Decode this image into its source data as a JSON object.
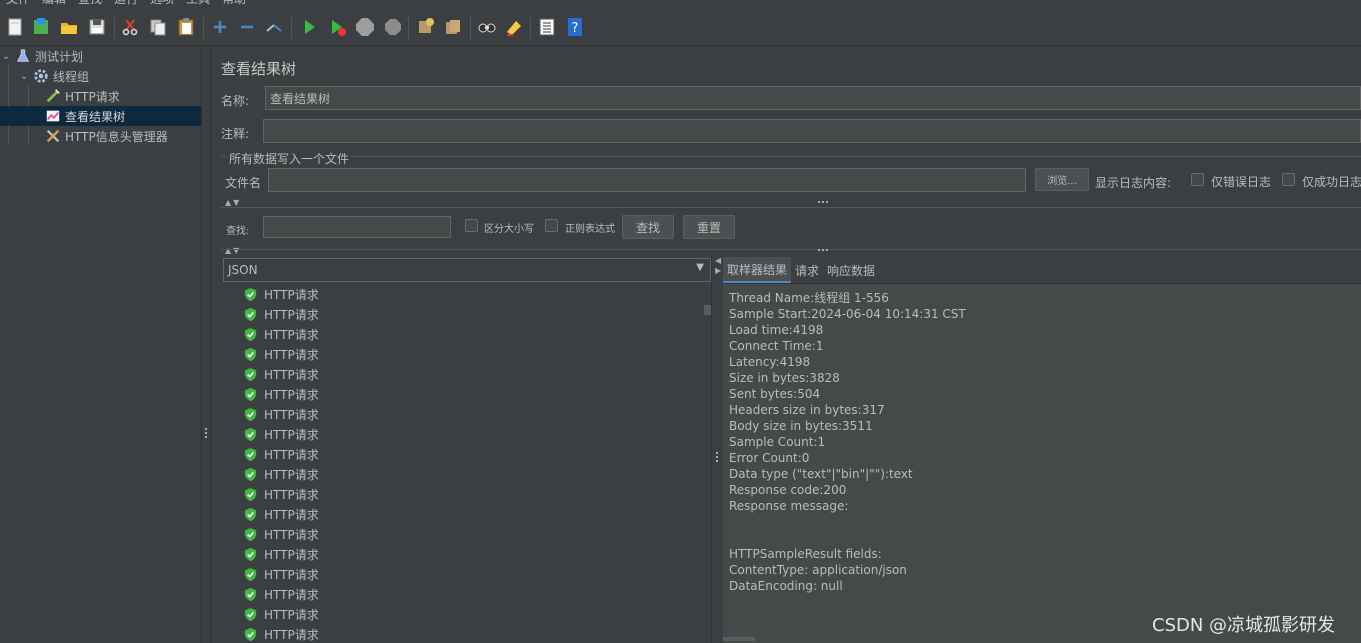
{
  "menu": [
    "文件",
    "编辑",
    "查找",
    "运行",
    "选项",
    "工具",
    "帮助"
  ],
  "toolbar": {
    "icons": [
      "new-icon",
      "templates-icon",
      "open-icon",
      "save-icon",
      "cut-icon",
      "copy-icon",
      "paste-icon",
      "expand-icon",
      "collapse-icon",
      "toggle-icon",
      "start-icon",
      "start-no-pause-icon",
      "stop-icon",
      "shutdown-icon",
      "clear-icon",
      "clear-all-icon",
      "search-icon",
      "reset-search-icon",
      "function-helper-icon",
      "help-icon"
    ]
  },
  "tree": {
    "nodes": [
      {
        "label": "测试计划",
        "icon": "flask-icon"
      },
      {
        "label": "线程组",
        "icon": "gear-icon"
      },
      {
        "label": "HTTP请求",
        "icon": "pipette-icon"
      },
      {
        "label": "查看结果树",
        "icon": "graph-icon"
      },
      {
        "label": "HTTP信息头管理器",
        "icon": "tools-icon"
      }
    ]
  },
  "panel": {
    "title": "查看结果树",
    "name_label": "名称:",
    "name_value": "查看结果树",
    "comment_label": "注释:",
    "comment_value": "",
    "file_section_label": "所有数据写入一个文件",
    "filename_label": "文件名",
    "filename_value": "",
    "browse_label": "浏览...",
    "log_content_label": "显示日志内容:",
    "errors_only_label": "仅错误日志",
    "success_only_label": "仅成功日志"
  },
  "search": {
    "label": "查找:",
    "value": "",
    "case_label": "区分大小写",
    "regex_label": "正则表达式",
    "find_button": "查找",
    "reset_button": "重置"
  },
  "renderer": {
    "selected": "JSON"
  },
  "results": {
    "items": [
      "HTTP请求",
      "HTTP请求",
      "HTTP请求",
      "HTTP请求",
      "HTTP请求",
      "HTTP请求",
      "HTTP请求",
      "HTTP请求",
      "HTTP请求",
      "HTTP请求",
      "HTTP请求",
      "HTTP请求",
      "HTTP请求",
      "HTTP请求",
      "HTTP请求",
      "HTTP请求",
      "HTTP请求",
      "HTTP请求"
    ]
  },
  "detail": {
    "tabs": [
      "取样器结果",
      "请求",
      "响应数据"
    ],
    "active_tab": 0,
    "lines": [
      "Thread Name:线程组 1-556",
      "Sample Start:2024-06-04 10:14:31 CST",
      "Load time:4198",
      "Connect Time:1",
      "Latency:4198",
      "Size in bytes:3828",
      "Sent bytes:504",
      "Headers size in bytes:317",
      "Body size in bytes:3511",
      "Sample Count:1",
      "Error Count:0",
      "Data type (\"text\"|\"bin\"|\"\"):text",
      "Response code:200",
      "Response message:",
      "",
      "",
      "HTTPSampleResult fields:",
      "ContentType: application/json",
      "DataEncoding: null"
    ]
  },
  "watermark": "CSDN @凉城孤影研发",
  "colors": {
    "background": "#3c3f41",
    "field": "#45494a",
    "selection": "#0d293e",
    "success_green": "#3fb83f",
    "accent_blue": "#4a88c7"
  }
}
